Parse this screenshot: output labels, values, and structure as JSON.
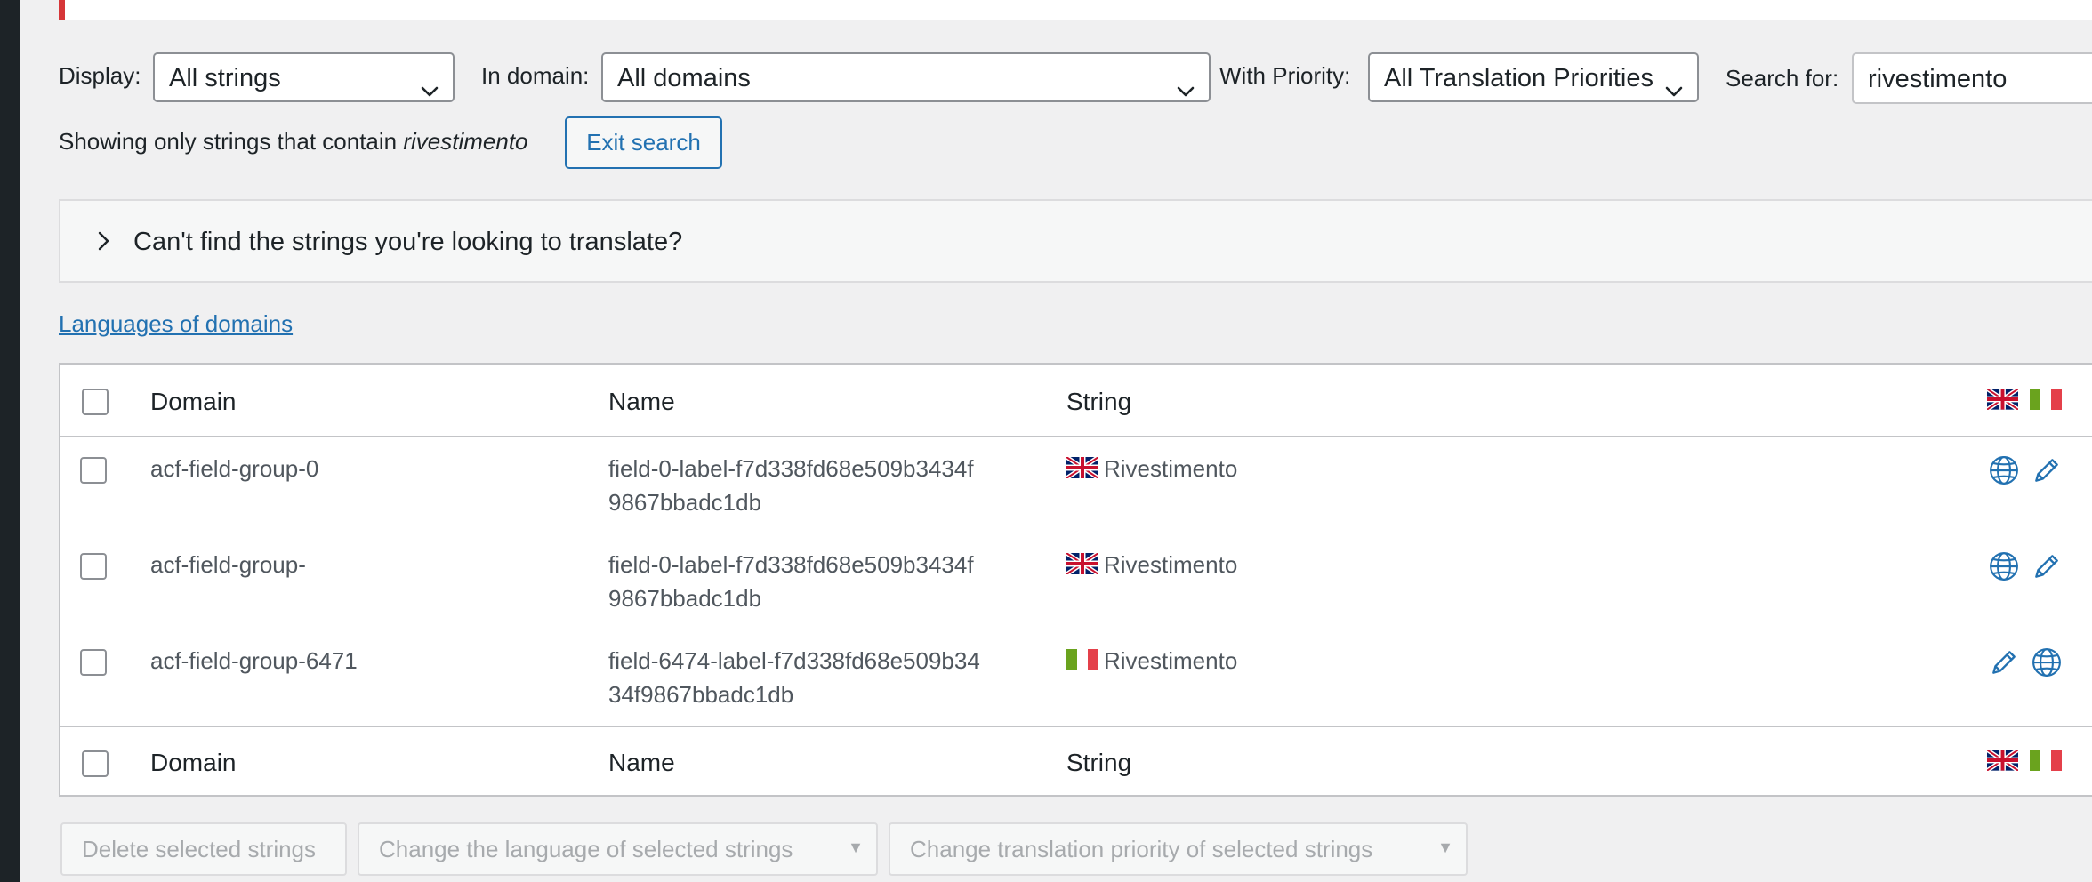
{
  "filters": {
    "display_label": "Display:",
    "display_value": "All strings",
    "domain_label": "In domain:",
    "domain_value": "All domains",
    "priority_label": "With Priority:",
    "priority_value": "All Translation Priorities",
    "search_label": "Search for:",
    "search_value": "rivestimento"
  },
  "search_status": {
    "prefix": "Showing only strings that contain ",
    "term": "rivestimento",
    "exit_label": "Exit search"
  },
  "help_panel": {
    "title": "Can't find the strings you're looking to translate?"
  },
  "languages_link": "Languages of domains",
  "table": {
    "columns": {
      "domain": "Domain",
      "name": "Name",
      "string": "String"
    },
    "rows": [
      {
        "domain": "acf-field-group-0",
        "name_line1": "field-0-label-f7d338fd68e509b3434f",
        "name_line2": "9867bbadc1db",
        "flag": "uk-flag",
        "string": "Rivestimento"
      },
      {
        "domain": "acf-field-group-",
        "name_line1": "field-0-label-f7d338fd68e509b3434f",
        "name_line2": "9867bbadc1db",
        "flag": "uk-flag",
        "string": "Rivestimento"
      },
      {
        "domain": "acf-field-group-6471",
        "name_line1": "field-6474-label-f7d338fd68e509b34",
        "name_line2": "34f9867bbadc1db",
        "flag": "italy-flag",
        "string": "Rivestimento"
      }
    ]
  },
  "bulk_actions": {
    "delete": "Delete selected strings",
    "change_language": "Change the language of selected strings",
    "change_priority": "Change translation priority of selected strings"
  },
  "colors": {
    "accent": "#2271b1",
    "alert": "#d63638",
    "background": "#f0f0f1",
    "disabled_text": "#a7aaad"
  }
}
